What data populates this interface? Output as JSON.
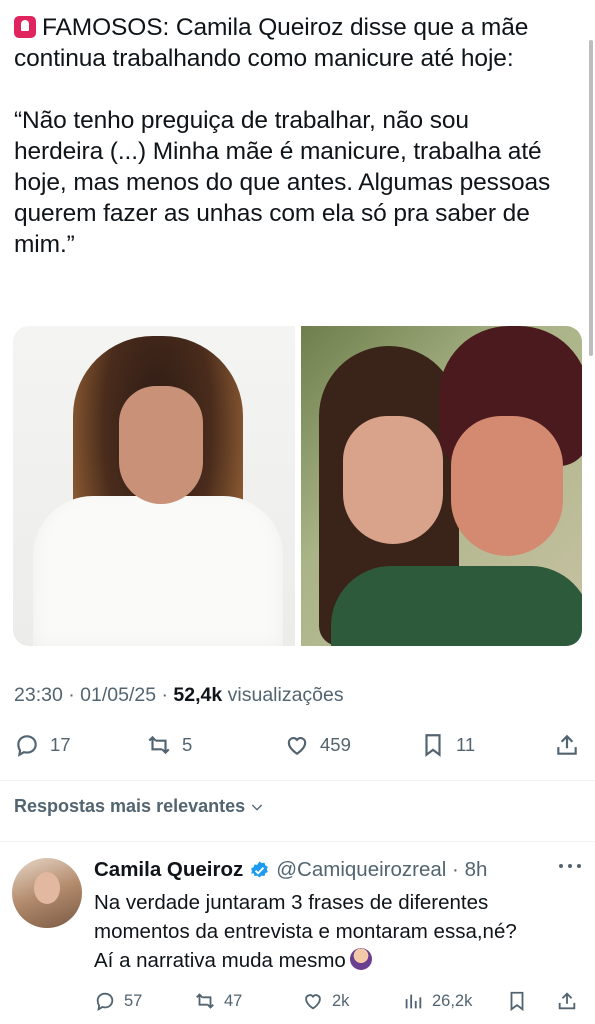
{
  "tweet": {
    "line1": "FAMOSOS: Camila Queiroz disse que a mãe",
    "line2": "continua trabalhando como manicure até hoje:",
    "quote1": "“Não tenho preguiça de trabalhar, não sou",
    "quote2": "herdeira (...) Minha mãe é manicure, trabalha até",
    "quote3": "hoje, mas menos do que antes. Algumas pessoas",
    "quote4": "querem fazer as unhas com ela só pra saber de",
    "quote5": "mim.”",
    "siren_icon": "police-light-emoji",
    "time": "23:30",
    "date": "01/05/25",
    "views_count": "52,4k",
    "views_label": "visualizações",
    "separator": "·"
  },
  "actions": {
    "replies": "17",
    "reposts": "5",
    "likes": "459",
    "bookmarks": "11"
  },
  "sort": {
    "label": "Respostas mais relevantes"
  },
  "reply": {
    "name": "Camila Queiroz",
    "handle": "@Camiqueirozreal",
    "dot": "·",
    "time": "8h",
    "text1": "Na verdade juntaram 3 frases de diferentes",
    "text2": "momentos da entrevista e montaram essa,né?",
    "text3": "Aí a narrativa muda mesmo",
    "emoji": "woman-shrugging-emoji",
    "replies": "57",
    "reposts": "47",
    "likes": "2k",
    "views": "26,2k"
  },
  "colors": {
    "text": "#0f1419",
    "secondary": "#536471",
    "verified": "#1d9bf0",
    "divider": "#eff3f4"
  }
}
